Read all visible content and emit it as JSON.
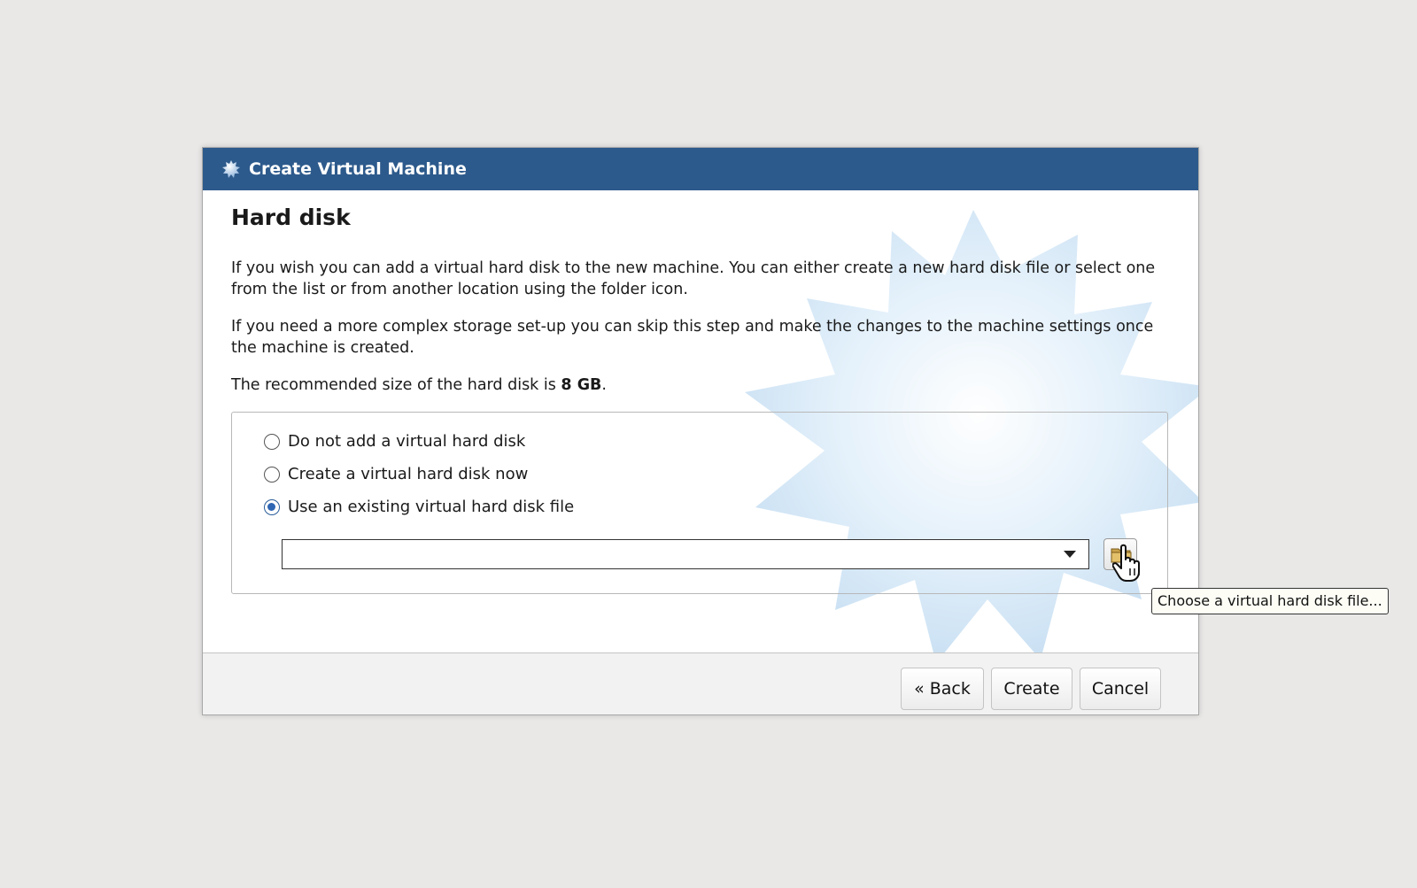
{
  "window": {
    "title": "Create Virtual Machine"
  },
  "page": {
    "heading": "Hard disk",
    "paragraph1": "If you wish you can add a virtual hard disk to the new machine. You can either create a new hard disk file or select one from the list or from another location using the folder icon.",
    "paragraph2": "If you need a more complex storage set-up you can skip this step and make the changes to the machine settings once the machine is created.",
    "recommended_prefix": "The recommended size of the hard disk is ",
    "recommended_size": "8 GB",
    "recommended_suffix": "."
  },
  "options": {
    "items": [
      {
        "label": "Do not add a virtual hard disk",
        "checked": false
      },
      {
        "label": "Create a virtual hard disk now",
        "checked": false
      },
      {
        "label": "Use an existing virtual hard disk file",
        "checked": true
      }
    ],
    "disk_select_value": "",
    "folder_tooltip": "Choose a virtual hard disk file..."
  },
  "footer": {
    "back_label": "« Back",
    "create_label": "Create",
    "cancel_label": "Cancel"
  },
  "colors": {
    "titlebar": "#2d5a8c",
    "radio_selected": "#2e66b4"
  },
  "icons": {
    "app": "virtualbox-icon",
    "folder": "folder-icon",
    "cursor": "hand-pointer-icon",
    "dropdown": "chevron-down-icon"
  }
}
